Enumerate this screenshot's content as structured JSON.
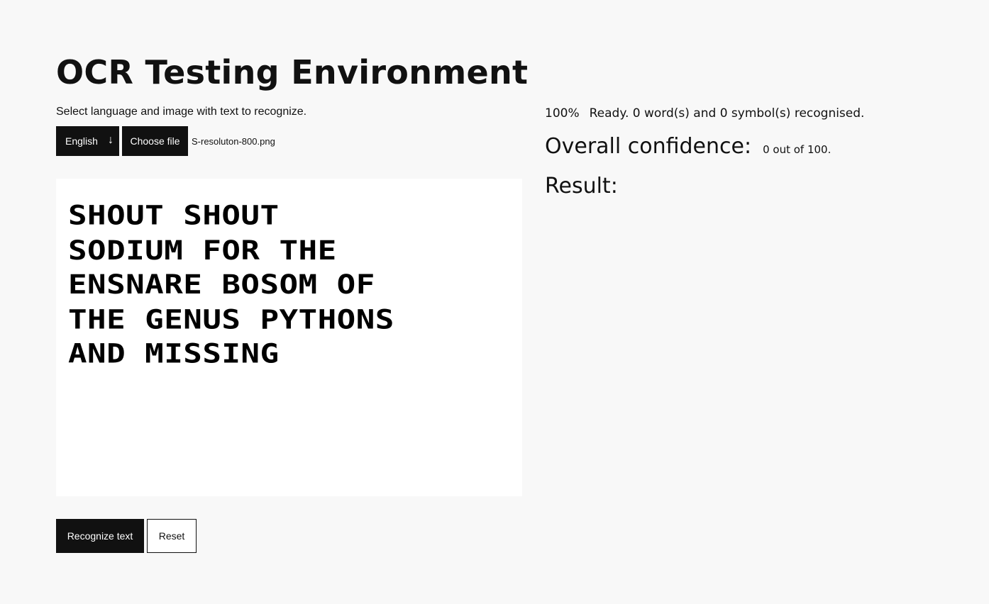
{
  "header": {
    "title": "OCR Testing Environment",
    "subtitle": "Select language and image with text to recognize."
  },
  "controls": {
    "language_selected": "English",
    "language_arrow": "↓",
    "file_button_label": "Choose file",
    "file_name": "S-resoluton-800.png"
  },
  "preview": {
    "lines": [
      "SHOUT SHOUT",
      "SODIUM FOR THE",
      "ENSNARE BOSOM OF",
      "THE GENUS PYTHONS",
      "AND MISSING"
    ]
  },
  "actions": {
    "recognize_label": "Recognize text",
    "reset_label": "Reset"
  },
  "status": {
    "progress": "100%",
    "message": "Ready. 0 word(s) and 0 symbol(s) recognised."
  },
  "confidence": {
    "label": "Overall confidence:",
    "value": "0 out of 100."
  },
  "result": {
    "label": "Result:",
    "text": ""
  },
  "colors": {
    "background": "#f8f8f8",
    "button": "#111111",
    "button_text": "#ffffff",
    "preview_background": "#ffffff"
  }
}
